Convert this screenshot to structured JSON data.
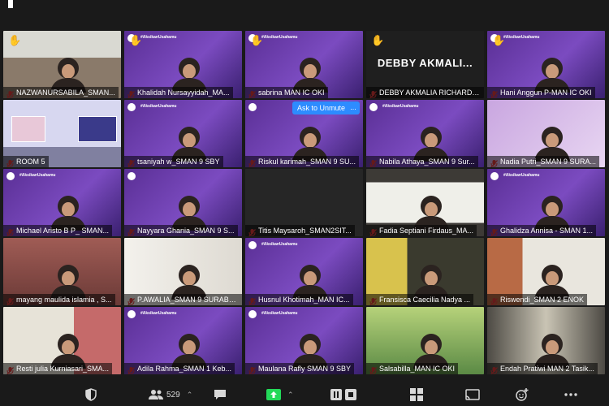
{
  "participants": [
    {
      "name": "NAZWANURSABILA_SMAN...",
      "hand": true,
      "bg": "classroom"
    },
    {
      "name": "Khalidah Nursayyidah_MA...",
      "hand": true,
      "bg": "purple",
      "hashtag": "#AksikanUsahamu"
    },
    {
      "name": "sabrina MAN IC OKI",
      "hand": true,
      "bg": "purple",
      "hashtag": "#AksikanUsahamu"
    },
    {
      "name": "DEBBY AKMALIA RICHARD_...",
      "hand": true,
      "bg": "dark",
      "display_name": "DEBBY AKMALI..."
    },
    {
      "name": "Hani Anggun P-MAN IC OKI",
      "hand": true,
      "bg": "purple",
      "hashtag": "#AksikanUsahamu"
    },
    {
      "name": "ROOM 5",
      "hand": false,
      "bg": "room",
      "active": true
    },
    {
      "name": "tsaniyah w_SMAN 9 SBY",
      "hand": false,
      "bg": "purple",
      "hashtag": "#AksikanUsahamu"
    },
    {
      "name": "Riskul karimah_SMAN 9 SU...",
      "hand": false,
      "bg": "purple",
      "unmute": "Ask to Unmute",
      "more": "..."
    },
    {
      "name": "Nabila Athaya_SMAN 9 Sur...",
      "hand": false,
      "bg": "purple",
      "hashtag": "#AksikanUsahamu"
    },
    {
      "name": "Nadia Putri_SMAN 9 SURA...",
      "hand": false,
      "bg": "lightpurple"
    },
    {
      "name": "Michael Aristo B P_ SMAN...",
      "hand": false,
      "bg": "purple",
      "hashtag": "#AksikanUsahamu"
    },
    {
      "name": "Nayyara Ghania_SMAN 9 S...",
      "hand": false,
      "bg": "purple"
    },
    {
      "name": "Titis Maysaroh_SMAN2SIT...",
      "hand": false,
      "bg": "black"
    },
    {
      "name": "Fadia Septiani Firdaus_MA...",
      "hand": false,
      "bg": "room2"
    },
    {
      "name": "Ghalidza Annisa - SMAN 1...",
      "hand": false,
      "bg": "purple",
      "hashtag": "#AksikanUsahamu"
    },
    {
      "name": "mayang maulida islamia , S...",
      "hand": false,
      "bg": "brown"
    },
    {
      "name": "P.AWALIA_SMAN 9 SURABA...",
      "hand": false,
      "bg": "wall"
    },
    {
      "name": "Husnul Khotimah_MAN IC...",
      "hand": false,
      "bg": "purple",
      "hashtag": "#AksikanUsahamu"
    },
    {
      "name": "Fransisca Caecilia Nadya ...",
      "hand": false,
      "bg": "yellowroom"
    },
    {
      "name": "Riswendi_SMAN 2 ENOK",
      "hand": false,
      "bg": "room3"
    },
    {
      "name": "Resti julia Kurniasari_SMA...",
      "hand": false,
      "bg": "room4"
    },
    {
      "name": "Adila Rahma_SMAN 1 Keb...",
      "hand": false,
      "bg": "purple",
      "hashtag": "#AksikanUsahamu"
    },
    {
      "name": "Maulana Rafly SMAN 9 SBY",
      "hand": false,
      "bg": "purple",
      "hashtag": "#AksikanUsahamu"
    },
    {
      "name": "Salsabilla_MAN IC OKI",
      "hand": false,
      "bg": "green"
    },
    {
      "name": "Endah Pratiwi MAN 2 Tasik...",
      "hand": false,
      "bg": "corridor"
    }
  ],
  "toolbar": {
    "participants_count": "529"
  },
  "colors": {
    "purple": "#6b3fa0",
    "accent_blue": "#2d8cff",
    "active_border": "#d8e84a",
    "muted_mic": "#e03a3a"
  }
}
